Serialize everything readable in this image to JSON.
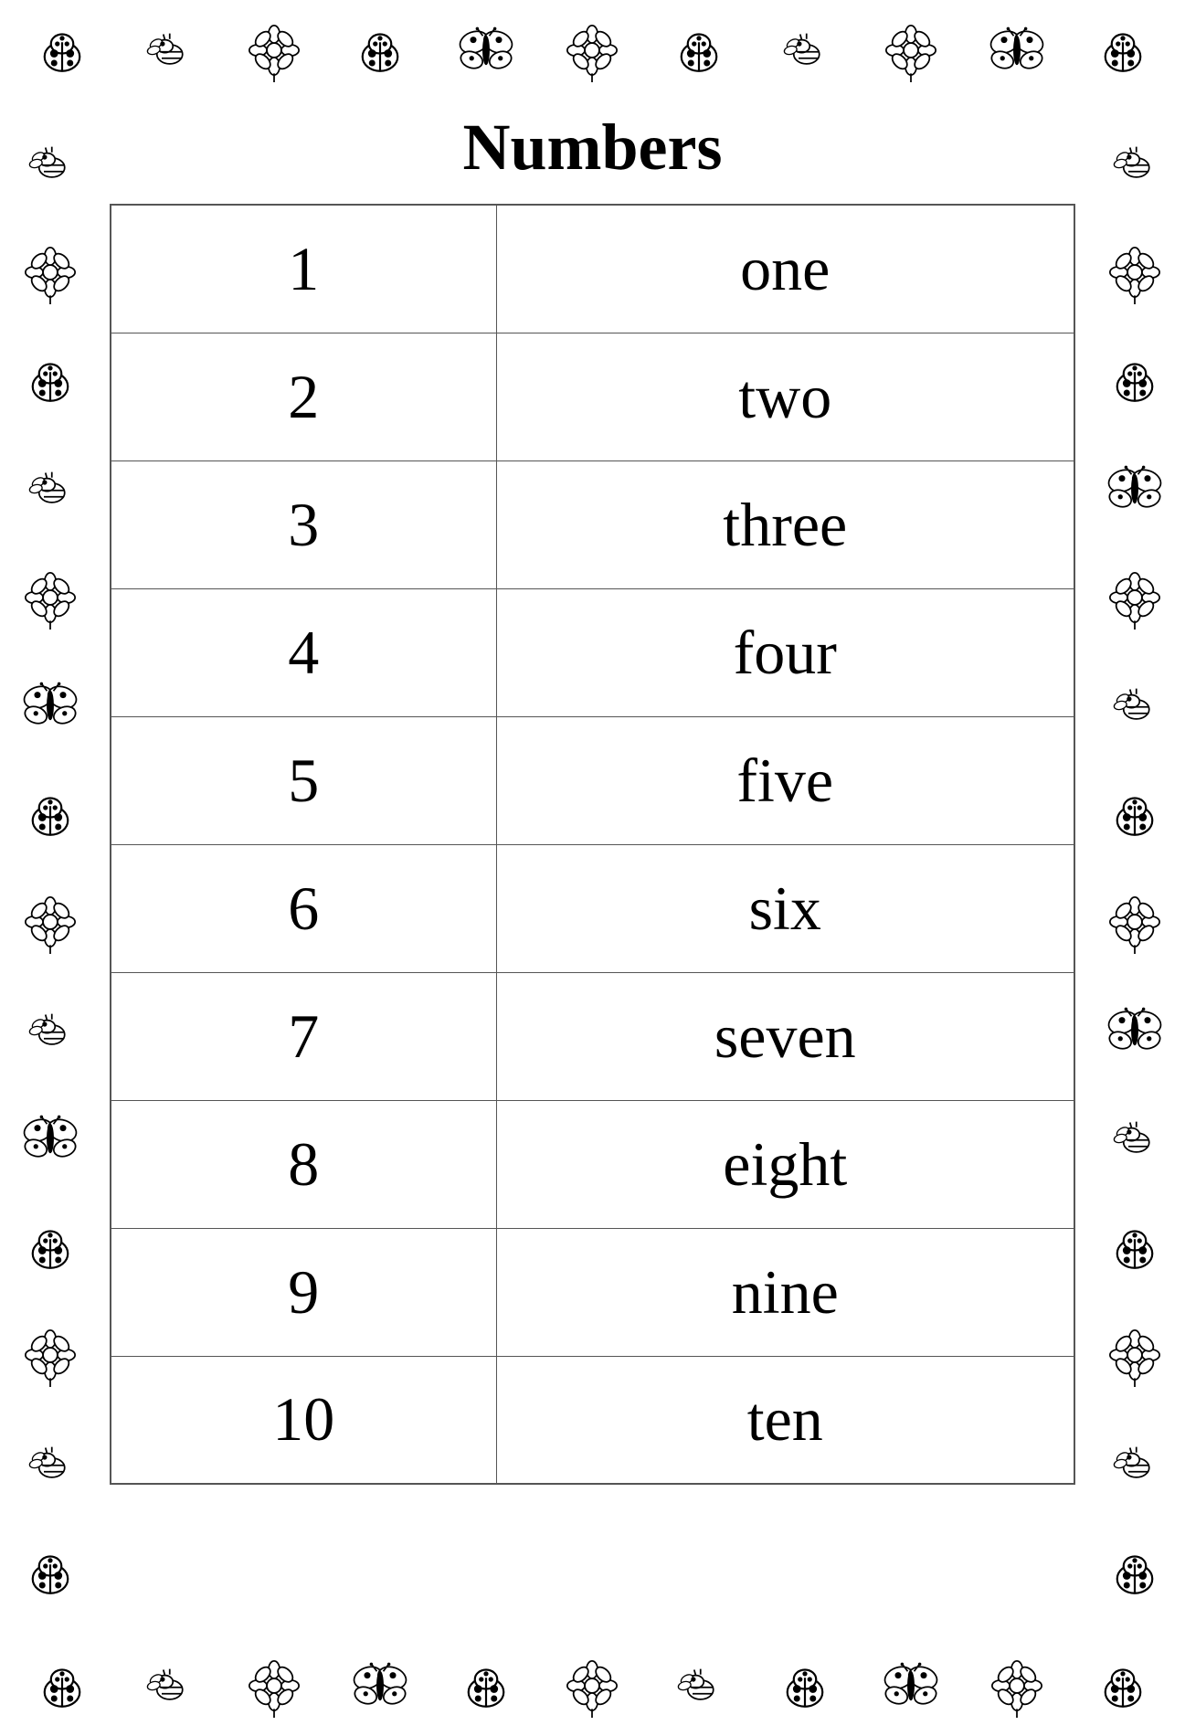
{
  "title": "Numbers",
  "table": {
    "rows": [
      {
        "numeral": "1",
        "word": "one"
      },
      {
        "numeral": "2",
        "word": "two"
      },
      {
        "numeral": "3",
        "word": "three"
      },
      {
        "numeral": "4",
        "word": "four"
      },
      {
        "numeral": "5",
        "word": "five"
      },
      {
        "numeral": "6",
        "word": "six"
      },
      {
        "numeral": "7",
        "word": "seven"
      },
      {
        "numeral": "8",
        "word": "eight"
      },
      {
        "numeral": "9",
        "word": "nine"
      },
      {
        "numeral": "10",
        "word": "ten"
      }
    ]
  }
}
